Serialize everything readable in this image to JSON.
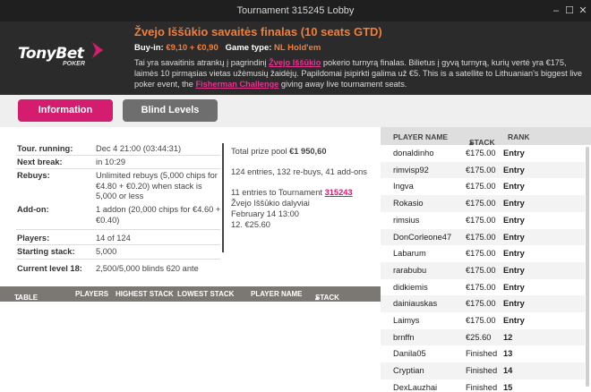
{
  "window": {
    "title": "Tournament 315245 Lobby",
    "minimize": "–",
    "maximize": "☐",
    "close": "✕"
  },
  "brand": {
    "name": "TonyBet",
    "sub": "POKER"
  },
  "header": {
    "title": "Žvejo Iššūkio savaitės finalas (10 seats GTD)",
    "buyin_label": "Buy-in:",
    "buyin_value": "€9,10 + €0,90",
    "gametype_label": "Game type:",
    "gametype_value": "NL Hold'em",
    "desc_1": "Tai yra savaitinis atrankų į pagrindinį ",
    "desc_link_1": "Žvejo Iššūkio",
    "desc_2": " pokerio turnyrą finalas. Bilietus į gyvą turnyrą, kurių vertė yra €175, laimės 10 pirmąsias vietas užėmusių žaidėjų. Papildomai įsipirkti galima už €5. This is a satellite to Lithuanian's biggest live poker event, the ",
    "desc_link_2": "Fisherman Challenge",
    "desc_3": " giving away live tournament seats."
  },
  "tabs": {
    "information": "Information",
    "blind_levels": "Blind Levels"
  },
  "info": {
    "running_label": "Tour. running:",
    "running_value": "Dec 4 21:00 (03:44:31)",
    "nextbreak_label": "Next break:",
    "nextbreak_value": "in 10:29",
    "rebuys_label": "Rebuys:",
    "rebuys_value": "Unlimited rebuys (5,000 chips for €4.80 + €0.20) when stack is 5,000 or less",
    "addon_label": "Add-on:",
    "addon_value": "1 addon (20,000 chips for €4.60 + €0.40)",
    "players_label": "Players:",
    "players_value": "14 of 124",
    "startstack_label": "Starting stack:",
    "startstack_value": "5,000",
    "level_label": "Current level 18:",
    "level_value": "2,500/5,000 blinds 620 ante",
    "prize_label": "Total prize pool",
    "prize_value": "€1 950,60",
    "entries": "124 entries, 132 re-buys, 41 add-ons",
    "qual_1": "11 entries to Tournament ",
    "qual_link": "315243",
    "qual_2": "Žvejo Iššūkio dalyviai",
    "qual_3": "February 14 13:00",
    "qual_4": "12. €25.60"
  },
  "table_header": {
    "table": "TABLE",
    "players": "PLAYERS",
    "highest": "HIGHEST STACK",
    "lowest": "LOWEST STACK",
    "player_name": "PLAYER NAME",
    "stack": "STACK"
  },
  "player_list": {
    "headers": {
      "name": "PLAYER NAME",
      "stack": "STACK",
      "rank": "RANK"
    },
    "rows": [
      {
        "name": "donaldinho",
        "stack": "€175.00",
        "rank": "Entry"
      },
      {
        "name": "rimvisp92",
        "stack": "€175.00",
        "rank": "Entry"
      },
      {
        "name": "Ingva",
        "stack": "€175.00",
        "rank": "Entry"
      },
      {
        "name": "Rokasio",
        "stack": "€175.00",
        "rank": "Entry"
      },
      {
        "name": "rimsius",
        "stack": "€175.00",
        "rank": "Entry"
      },
      {
        "name": "DonCorleone47",
        "stack": "€175.00",
        "rank": "Entry"
      },
      {
        "name": "Labarum",
        "stack": "€175.00",
        "rank": "Entry"
      },
      {
        "name": "rarabubu",
        "stack": "€175.00",
        "rank": "Entry"
      },
      {
        "name": "didkiemis",
        "stack": "€175.00",
        "rank": "Entry"
      },
      {
        "name": "dainiauskas",
        "stack": "€175.00",
        "rank": "Entry"
      },
      {
        "name": "Laimys",
        "stack": "€175.00",
        "rank": "Entry"
      },
      {
        "name": "brnffn",
        "stack": "€25.60",
        "rank": "12"
      },
      {
        "name": "Danila05",
        "stack": "Finished",
        "rank": "13"
      },
      {
        "name": "Cryptian",
        "stack": "Finished",
        "rank": "14"
      },
      {
        "name": "DexLauzhai",
        "stack": "Finished",
        "rank": "15"
      }
    ]
  }
}
